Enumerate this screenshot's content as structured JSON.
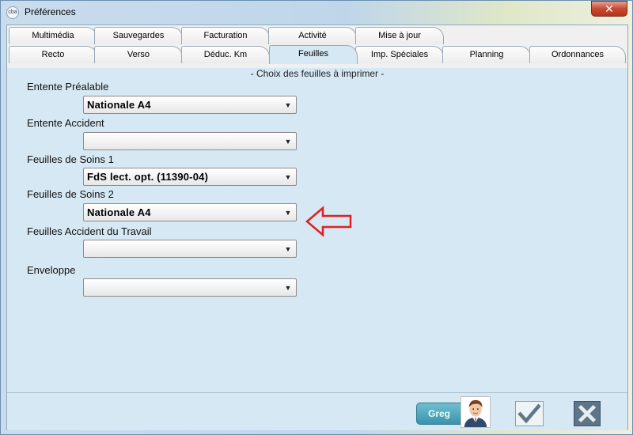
{
  "window": {
    "title": "Préférences",
    "app_icon_text": "cba",
    "close_glyph": "✕"
  },
  "tabs_row1": [
    "Multimédia",
    "Sauvegardes",
    "Facturation",
    "Activité",
    "Mise à jour"
  ],
  "tabs_row2": [
    "Recto",
    "Verso",
    "Déduc. Km",
    "Feuilles",
    "Imp. Spéciales",
    "Planning",
    "Ordonnances"
  ],
  "active_tab": "Feuilles",
  "section_title": "- Choix des feuilles à imprimer -",
  "fields": [
    {
      "label": "Entente Préalable",
      "value": "Nationale A4"
    },
    {
      "label": "Entente Accident",
      "value": ""
    },
    {
      "label": "Feuilles de Soins 1",
      "value": "FdS lect. opt. (11390-04)"
    },
    {
      "label": "Feuilles de Soins 2",
      "value": "Nationale A4"
    },
    {
      "label": "Feuilles Accident du Travail",
      "value": ""
    },
    {
      "label": "Enveloppe",
      "value": ""
    }
  ],
  "combo_arrow": "▼",
  "footer": {
    "user_name": "Greg"
  },
  "icons": {
    "ok": "check-icon",
    "cancel": "x-icon",
    "pointer": "left-arrow-icon"
  },
  "colors": {
    "panel": "#d6e8f3",
    "pointer_arrow": "#e02020"
  }
}
